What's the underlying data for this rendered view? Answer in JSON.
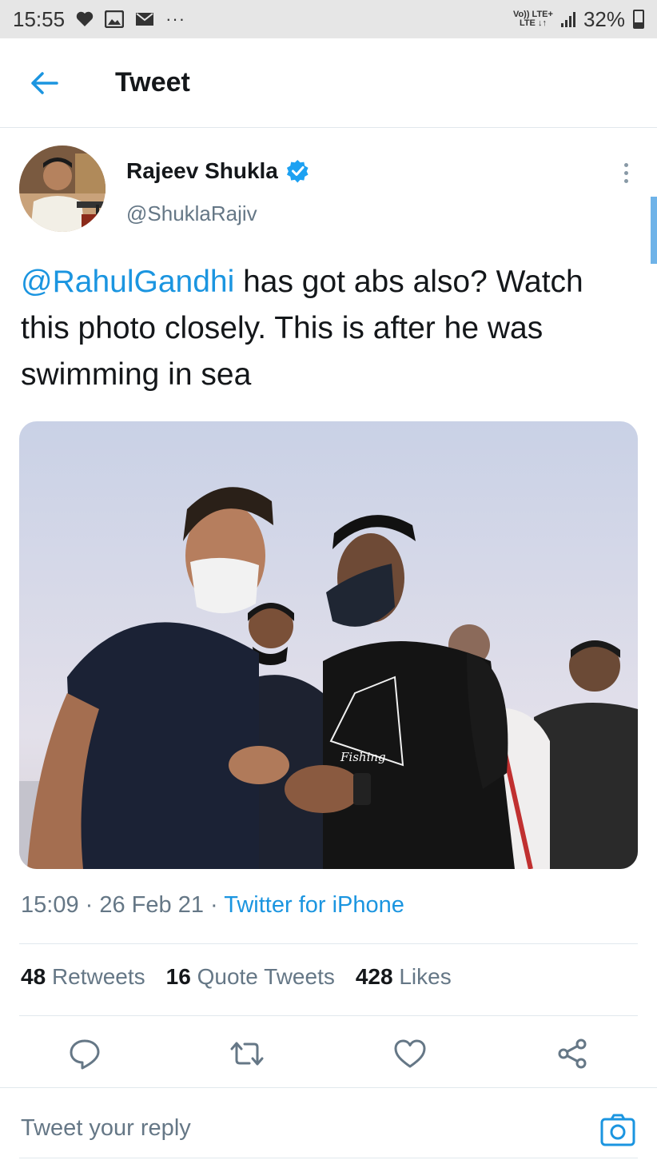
{
  "status_bar": {
    "time": "15:55",
    "network_top": "Vo)) LTE+",
    "network_bottom": "LTE ↓↑",
    "battery": "32%",
    "battery_level": 0.32,
    "more": "···"
  },
  "header": {
    "title": "Tweet"
  },
  "tweet": {
    "author_name": "Rajeev Shukla",
    "author_handle": "@ShuklaRajiv",
    "text_mention": "@RahulGandhi",
    "text_body": " has got abs also? Watch this photo closely. This is after he was swimming in sea",
    "photo_caption_print": "Fishing",
    "time": "15:09",
    "date": "26 Feb 21",
    "source": "Twitter for iPhone",
    "retweets_count": "48",
    "retweets_label": "Retweets",
    "quotes_count": "16",
    "quotes_label": "Quote Tweets",
    "likes_count": "428",
    "likes_label": "Likes"
  },
  "reply": {
    "placeholder": "Tweet your reply"
  },
  "colors": {
    "accent": "#1b95e0",
    "verified": "#1da1f2",
    "muted": "#657786"
  }
}
